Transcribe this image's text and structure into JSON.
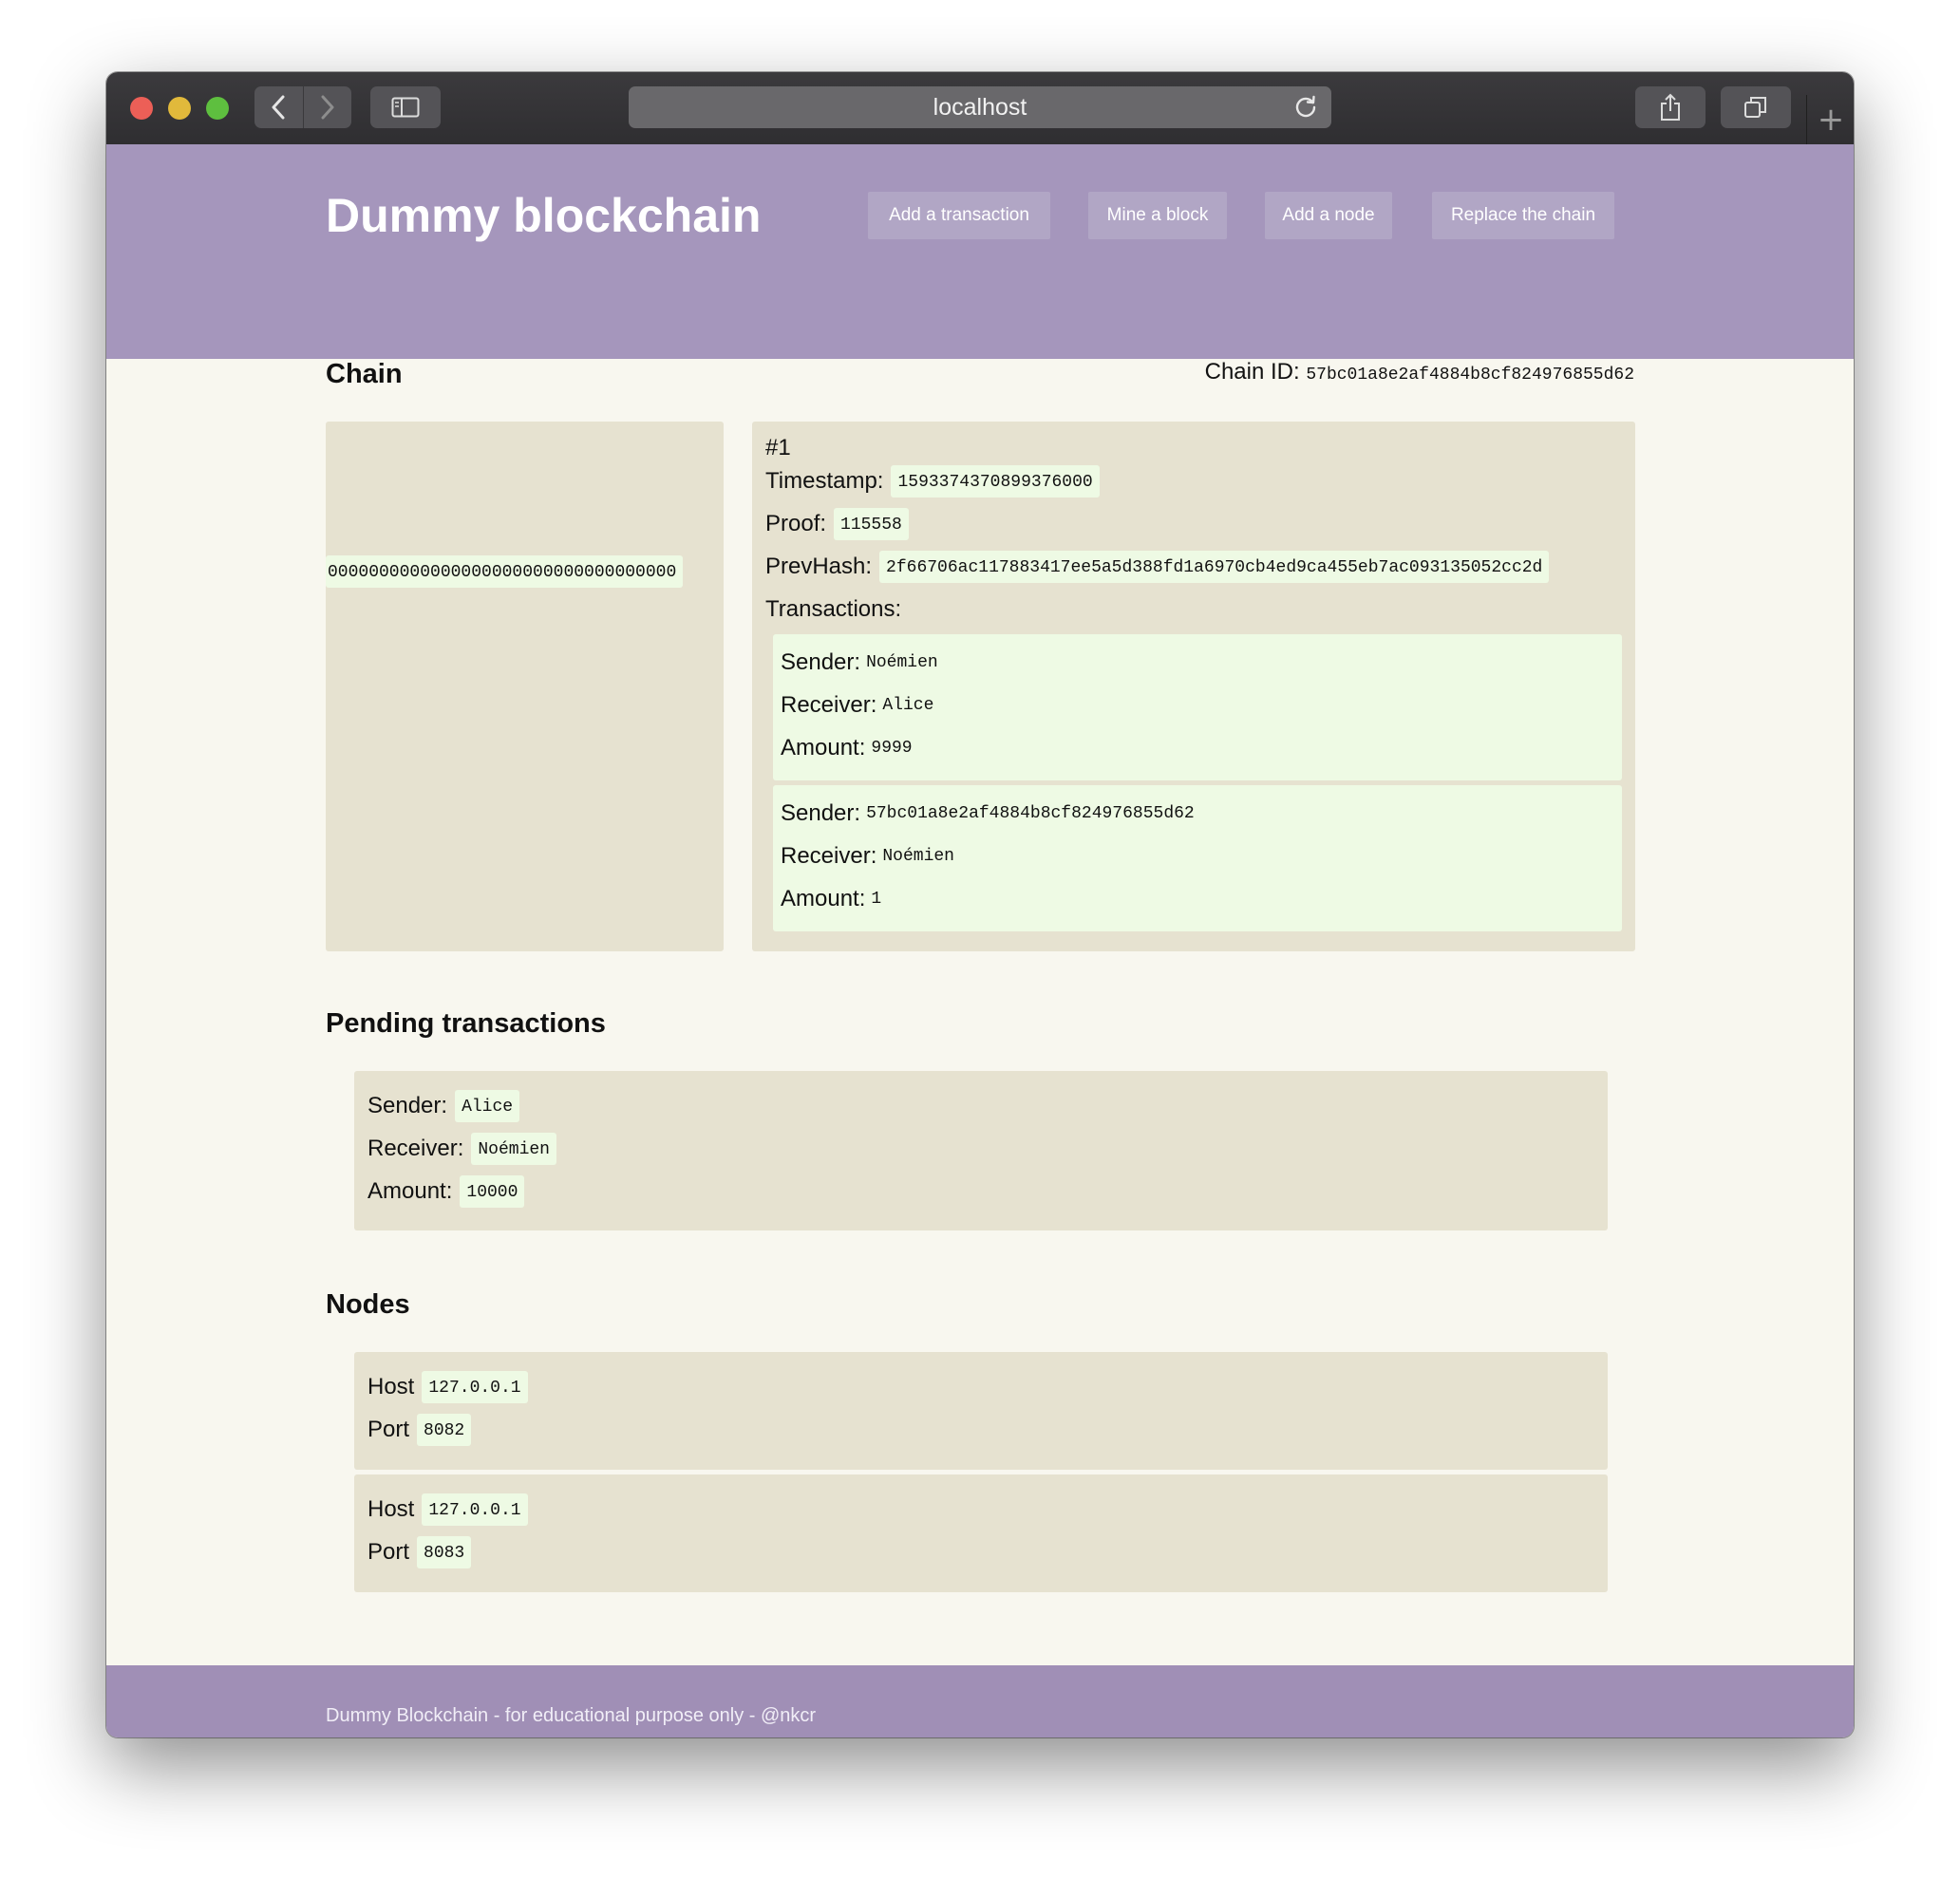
{
  "browser": {
    "url": "localhost"
  },
  "site": {
    "title": "Dummy blockchain",
    "nav": [
      "Add a transaction",
      "Mine a block",
      "Add a node",
      "Replace the chain"
    ]
  },
  "chain": {
    "section_title": "Chain",
    "chain_id_label": "Chain ID:",
    "chain_id": "57bc01a8e2af4884b8cf824976855d62",
    "genesis_hash": "0000000000000000000000000000000000",
    "blocks": [
      {
        "index": "#1",
        "timestamp_label": "Timestamp:",
        "timestamp": "1593374370899376000",
        "proof_label": "Proof:",
        "proof": "115558",
        "prevhash_label": "PrevHash:",
        "prevhash": "2f66706ac117883417ee5a5d388fd1a6970cb4ed9ca455eb7ac093135052cc2d",
        "transactions_label": "Transactions:",
        "transactions": [
          {
            "sender": "Noémien",
            "receiver": "Alice",
            "amount": "9999"
          },
          {
            "sender": "57bc01a8e2af4884b8cf824976855d62",
            "receiver": "Noémien",
            "amount": "1"
          }
        ]
      }
    ]
  },
  "labels": {
    "sender": "Sender:",
    "receiver": "Receiver:",
    "amount": "Amount:",
    "host": "Host",
    "port": "Port"
  },
  "pending": {
    "section_title": "Pending transactions",
    "transactions": [
      {
        "sender": "Alice",
        "receiver": "Noémien",
        "amount": "10000"
      }
    ]
  },
  "nodes": {
    "section_title": "Nodes",
    "items": [
      {
        "host": "127.0.0.1",
        "port": "8082"
      },
      {
        "host": "127.0.0.1",
        "port": "8083"
      }
    ]
  },
  "footer": {
    "text": "Dummy Blockchain - for educational purpose only - @nkcr"
  },
  "icons": {
    "back": "chevron-left-icon",
    "forward": "chevron-right-icon",
    "sidebar": "sidebar-icon",
    "reload": "reload-icon",
    "share": "share-icon",
    "tabs": "tabs-icon",
    "new_tab": "plus-icon"
  },
  "colors": {
    "header": "#a596bc",
    "nav_button": "#b1a6c5",
    "panel": "#e6e2d0",
    "chip": "#eefae4",
    "page_bg": "#f8f7ef",
    "footer": "#a08fb6"
  }
}
